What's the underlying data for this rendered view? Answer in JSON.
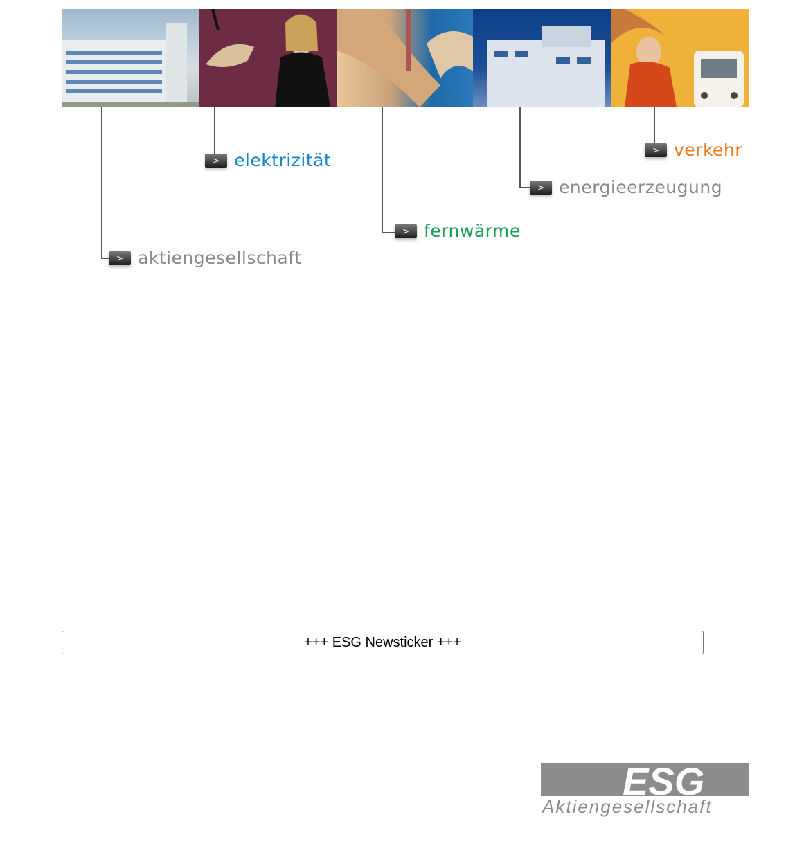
{
  "nav": {
    "aktiengesellschaft": "aktiengesellschaft",
    "elektrizitaet": "elektrizität",
    "fernwaerme": "fernwärme",
    "energieerzeugung": "energieerzeugung",
    "verkehr": "verkehr"
  },
  "colors": {
    "aktiengesellschaft": "#8a8a8a",
    "elektrizitaet": "#1a86c8",
    "fernwaerme": "#1aa05a",
    "energieerzeugung": "#8a8a8a",
    "verkehr": "#f07a1a"
  },
  "ticker": {
    "text": "+++ ESG Newsticker +++"
  },
  "logo": {
    "brand": "ESG",
    "subtitle": "Aktiengesellschaft"
  },
  "icons": {
    "nav_arrow": "chevron-right-icon"
  }
}
